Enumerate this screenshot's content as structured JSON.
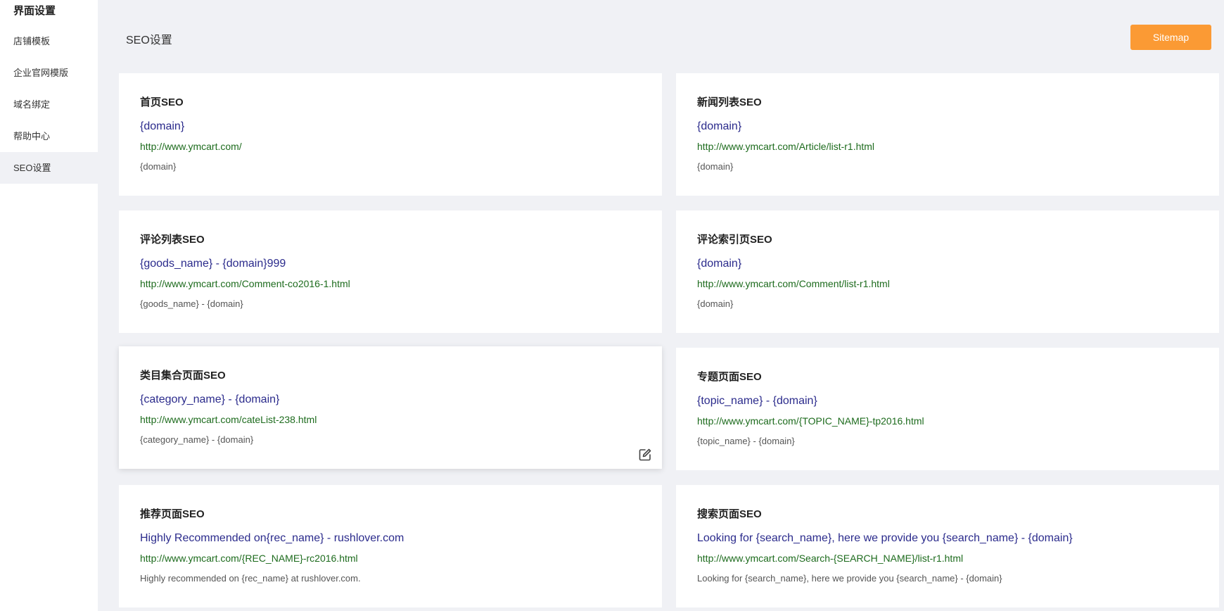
{
  "sidebar": {
    "title": "界面设置",
    "items": [
      {
        "label": "店铺模板"
      },
      {
        "label": "企业官网模版"
      },
      {
        "label": "域名绑定"
      },
      {
        "label": "帮助中心"
      },
      {
        "label": "SEO设置"
      }
    ]
  },
  "header": {
    "title": "SEO设置",
    "sitemap_label": "Sitemap"
  },
  "cards": [
    {
      "title": "首页SEO",
      "seo_title": "{domain}",
      "url": "http://www.ymcart.com/",
      "desc": "{domain}"
    },
    {
      "title": "新闻列表SEO",
      "seo_title": "{domain}",
      "url": "http://www.ymcart.com/Article/list-r1.html",
      "desc": "{domain}"
    },
    {
      "title": "评论列表SEO",
      "seo_title": "{goods_name} - {domain}999",
      "url": "http://www.ymcart.com/Comment-co2016-1.html",
      "desc": "{goods_name} - {domain}"
    },
    {
      "title": "评论索引页SEO",
      "seo_title": "{domain}",
      "url": "http://www.ymcart.com/Comment/list-r1.html",
      "desc": "{domain}"
    },
    {
      "title": "类目集合页面SEO",
      "seo_title": "{category_name} - {domain}",
      "url": "http://www.ymcart.com/cateList-238.html",
      "desc": "{category_name} - {domain}"
    },
    {
      "title": "专题页面SEO",
      "seo_title": "{topic_name} - {domain}",
      "url": "http://www.ymcart.com/{TOPIC_NAME}-tp2016.html",
      "desc": "{topic_name} - {domain}"
    },
    {
      "title": "推荐页面SEO",
      "seo_title": "Highly Recommended on{rec_name} - rushlover.com",
      "url": "http://www.ymcart.com/{REC_NAME}-rc2016.html",
      "desc": "Highly recommended on {rec_name} at rushlover.com."
    },
    {
      "title": "搜索页面SEO",
      "seo_title": "Looking for {search_name}, here we provide you {search_name} - {domain}",
      "url": "http://www.ymcart.com/Search-{SEARCH_NAME}/list-r1.html",
      "desc": "Looking for {search_name}, here we provide you {search_name} - {domain}"
    }
  ],
  "colors": {
    "accent": "#fb9a34",
    "seo_title": "#2b2b8c",
    "url": "#1d6b1d"
  },
  "icons": {
    "edit": "edit-icon"
  }
}
